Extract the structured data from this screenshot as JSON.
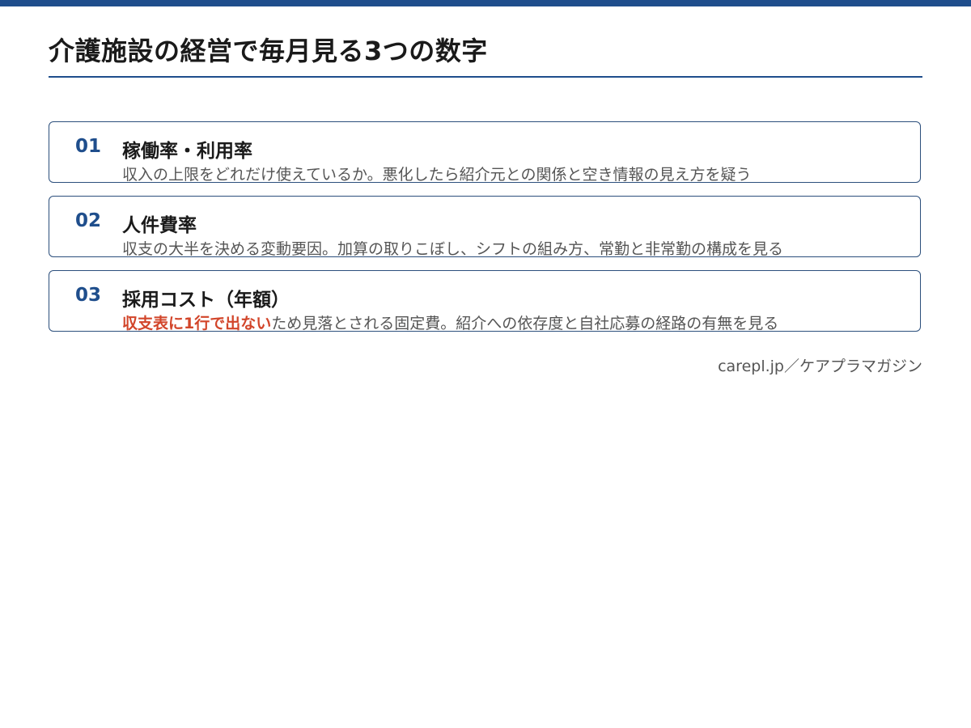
{
  "page": {
    "title": "介護施設の経営で毎月見る3つの数字",
    "credit": "carepl.jp／ケアプラマガジン"
  },
  "items": [
    {
      "number": "01",
      "title": "稼働率・利用率",
      "desc_highlight": "",
      "desc": "収入の上限をどれだけ使えているか。悪化したら紹介元との関係と空き情報の見え方を疑う"
    },
    {
      "number": "02",
      "title": "人件費率",
      "desc_highlight": "",
      "desc": "収支の大半を決める変動要因。加算の取りこぼし、シフトの組み方、常勤と非常勤の構成を見る"
    },
    {
      "number": "03",
      "title": "採用コスト（年額）",
      "desc_highlight": "収支表に1行で出ない",
      "desc": "ため見落とされる固定費。紹介への依存度と自社応募の経路の有無を見る"
    }
  ],
  "colors": {
    "accent": "#1f4e8c",
    "highlight": "#d2452a",
    "text": "#1a1a1a",
    "muted": "#555555"
  }
}
